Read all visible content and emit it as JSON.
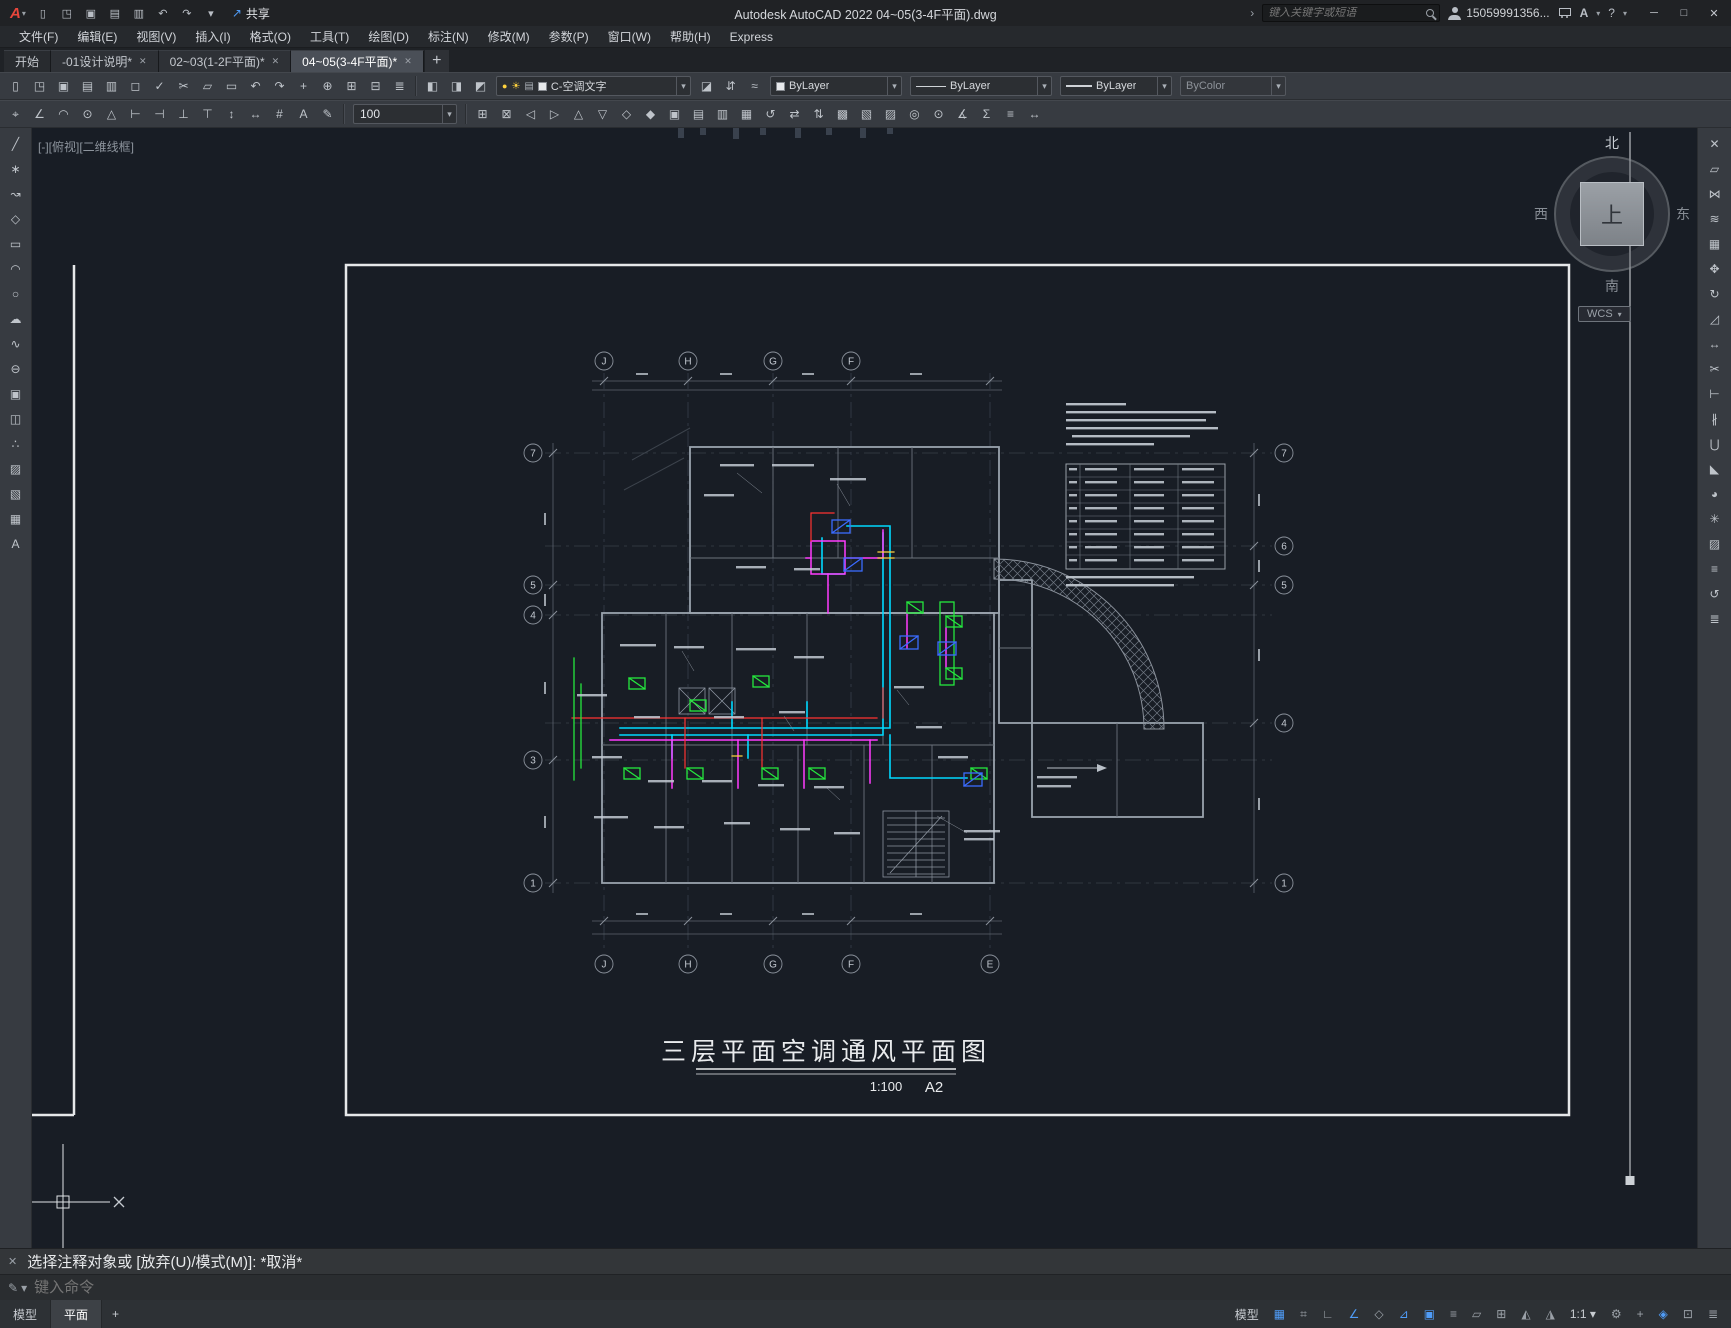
{
  "titlebar": {
    "logo": "A",
    "logo_caret": "▾",
    "qat": [
      {
        "name": "new-file-icon",
        "glyph": "▯"
      },
      {
        "name": "open-file-icon",
        "glyph": "◳"
      },
      {
        "name": "save-icon",
        "glyph": "▣"
      },
      {
        "name": "save-as-icon",
        "glyph": "▤"
      },
      {
        "name": "plot-icon",
        "glyph": "▥"
      },
      {
        "name": "undo-icon",
        "glyph": "↶"
      },
      {
        "name": "redo-icon",
        "glyph": "↷"
      },
      {
        "name": "qat-customize-icon",
        "glyph": "▾"
      }
    ],
    "share_icon": "↗",
    "share_label": "共享",
    "title": "Autodesk AutoCAD 2022   04~05(3-4F平面).dwg",
    "search_chevron": "›",
    "search_placeholder": "键入关键字或短语",
    "username": "15059991356...",
    "a_badge": "A",
    "help_badge": "?",
    "window": {
      "minimize": "─",
      "maximize": "□",
      "close": "✕"
    }
  },
  "menubar": {
    "items": [
      "文件(F)",
      "编辑(E)",
      "视图(V)",
      "插入(I)",
      "格式(O)",
      "工具(T)",
      "绘图(D)",
      "标注(N)",
      "修改(M)",
      "参数(P)",
      "窗口(W)",
      "帮助(H)",
      "Express"
    ]
  },
  "filetabs": {
    "tabs": [
      "开始",
      "-01设计说明*",
      "02~03(1-2F平面)*",
      "04~05(3-4F平面)*"
    ],
    "close_glyph": "✕",
    "new_tab": "+"
  },
  "toolbar": {
    "row1a": [
      {
        "name": "new-icon",
        "glyph": "▯"
      },
      {
        "name": "open-icon",
        "glyph": "◳"
      },
      {
        "name": "save-icon",
        "glyph": "▣"
      },
      {
        "name": "save-as-icon",
        "glyph": "▤"
      },
      {
        "name": "plot-icon",
        "glyph": "▥"
      },
      {
        "name": "plot-preview-icon",
        "glyph": "◻"
      },
      {
        "name": "spell-check-icon",
        "glyph": "✓"
      },
      {
        "name": "cut-icon",
        "glyph": "✂"
      },
      {
        "name": "copy-clip-icon",
        "glyph": "▱"
      },
      {
        "name": "paste-icon",
        "glyph": "▭"
      },
      {
        "name": "undo-icon",
        "glyph": "↶"
      },
      {
        "name": "redo-icon",
        "glyph": "↷"
      },
      {
        "name": "pan-icon",
        "glyph": "+"
      },
      {
        "name": "zoom-realtime-icon",
        "glyph": "⊕"
      },
      {
        "name": "zoom-window-icon",
        "glyph": "⊞"
      },
      {
        "name": "zoom-previous-icon",
        "glyph": "⊟"
      },
      {
        "name": "layer-properties-icon",
        "glyph": "≣"
      }
    ],
    "layer_tools": [
      {
        "name": "layer-states-icon",
        "glyph": "◧"
      },
      {
        "name": "layer-isolate-icon",
        "glyph": "◨"
      },
      {
        "name": "layer-unisolate-icon",
        "glyph": "◩"
      }
    ],
    "layer_combo": "C-空调文字",
    "row1b": [
      {
        "name": "make-current-layer-icon",
        "glyph": "◪"
      },
      {
        "name": "layer-previous-icon",
        "glyph": "⇵"
      },
      {
        "name": "match-properties-icon",
        "glyph": "≈"
      }
    ],
    "color_combo": "ByLayer",
    "linetype_combo": "ByLayer",
    "lineweight_combo": "ByLayer",
    "plotstyle_combo": "ByColor",
    "row2a": [
      {
        "name": "dim-center-mark-icon",
        "glyph": "⌖"
      },
      {
        "name": "dim-angular-icon",
        "glyph": "∠"
      },
      {
        "name": "dim-arc-length-icon",
        "glyph": "◠"
      },
      {
        "name": "dim-radius-icon",
        "glyph": "⊙"
      },
      {
        "name": "geometric-tolerance-icon",
        "glyph": "△"
      },
      {
        "name": "dim-baseline-icon",
        "glyph": "⊢"
      },
      {
        "name": "dim-continue-icon",
        "glyph": "⊣"
      },
      {
        "name": "dim-ordinate-icon",
        "glyph": "⊥"
      },
      {
        "name": "datum-icon",
        "glyph": "⊤"
      },
      {
        "name": "dim-vertical-icon",
        "glyph": "↕"
      },
      {
        "name": "dim-horizontal-icon",
        "glyph": "↔"
      },
      {
        "name": "snap-grid-icon",
        "glyph": "#"
      },
      {
        "name": "text-style-icon",
        "glyph": "A"
      },
      {
        "name": "edit-text-icon",
        "glyph": "✎"
      }
    ],
    "text_height": "100",
    "row2b": [
      {
        "name": "table-cell-icon",
        "glyph": "⊞"
      },
      {
        "name": "merge-cells-icon",
        "glyph": "⊠"
      },
      {
        "name": "align-left-icon",
        "glyph": "◁"
      },
      {
        "name": "align-right-icon",
        "glyph": "▷"
      },
      {
        "name": "align-top-icon",
        "glyph": "△"
      },
      {
        "name": "align-bottom-icon",
        "glyph": "▽"
      },
      {
        "name": "block-icon",
        "glyph": "◇"
      },
      {
        "name": "block-edit-icon",
        "glyph": "◆"
      },
      {
        "name": "attach-xref-icon",
        "glyph": "▣"
      },
      {
        "name": "image-attach-icon",
        "glyph": "▤"
      },
      {
        "name": "ole-object-icon",
        "glyph": "▥"
      },
      {
        "name": "field-icon",
        "glyph": "▦"
      },
      {
        "name": "update-icon",
        "glyph": "↺"
      },
      {
        "name": "sync-icon",
        "glyph": "⇄"
      },
      {
        "name": "draw-order-icon",
        "glyph": "⇅"
      },
      {
        "name": "region-icon",
        "glyph": "▩"
      },
      {
        "name": "boundary-icon",
        "glyph": "▧"
      },
      {
        "name": "wipeout-icon",
        "glyph": "▨"
      },
      {
        "name": "donut-icon",
        "glyph": "◎"
      },
      {
        "name": "point-style-icon",
        "glyph": "⊙"
      },
      {
        "name": "measure-icon",
        "glyph": "∡"
      },
      {
        "name": "area-icon",
        "glyph": "Σ"
      },
      {
        "name": "list-icon",
        "glyph": "≡"
      },
      {
        "name": "distance-icon",
        "glyph": "↔"
      }
    ]
  },
  "side_toolbars": {
    "left": [
      {
        "name": "line-icon",
        "glyph": "╱"
      },
      {
        "name": "construction-line-icon",
        "glyph": "∗"
      },
      {
        "name": "polyline-icon",
        "glyph": "↝"
      },
      {
        "name": "polygon-icon",
        "glyph": "◇"
      },
      {
        "name": "rectangle-icon",
        "glyph": "▭"
      },
      {
        "name": "arc-icon",
        "glyph": "◠"
      },
      {
        "name": "circle-icon",
        "glyph": "○"
      },
      {
        "name": "revision-cloud-icon",
        "glyph": "☁"
      },
      {
        "name": "spline-icon",
        "glyph": "∿"
      },
      {
        "name": "ellipse-icon",
        "glyph": "⊖"
      },
      {
        "name": "insert-block-icon",
        "glyph": "▣"
      },
      {
        "name": "create-block-icon",
        "glyph": "◫"
      },
      {
        "name": "point-icon",
        "glyph": "∴"
      },
      {
        "name": "hatch-icon",
        "glyph": "▨"
      },
      {
        "name": "gradient-icon",
        "glyph": "▧"
      },
      {
        "name": "table-icon",
        "glyph": "▦"
      },
      {
        "name": "multiline-text-icon",
        "glyph": "A"
      }
    ],
    "right": [
      {
        "name": "erase-icon",
        "glyph": "✕"
      },
      {
        "name": "copy-icon",
        "glyph": "▱"
      },
      {
        "name": "mirror-icon",
        "glyph": "⋈"
      },
      {
        "name": "offset-icon",
        "glyph": "≋"
      },
      {
        "name": "array-icon",
        "glyph": "▦"
      },
      {
        "name": "move-icon",
        "glyph": "✥"
      },
      {
        "name": "rotate-icon",
        "glyph": "↻"
      },
      {
        "name": "scale-icon",
        "glyph": "◿"
      },
      {
        "name": "stretch-icon",
        "glyph": "↔"
      },
      {
        "name": "trim-icon",
        "glyph": "✂"
      },
      {
        "name": "extend-icon",
        "glyph": "⊢"
      },
      {
        "name": "break-icon",
        "glyph": "∦"
      },
      {
        "name": "join-icon",
        "glyph": "⋃"
      },
      {
        "name": "chamfer-icon",
        "glyph": "◣"
      },
      {
        "name": "fillet-icon",
        "glyph": "◕"
      },
      {
        "name": "explode-icon",
        "glyph": "✳"
      },
      {
        "name": "hatch-edit-icon",
        "glyph": "▨"
      },
      {
        "name": "properties-icon",
        "glyph": "≡"
      },
      {
        "name": "undo-mark-icon",
        "glyph": "↺"
      },
      {
        "name": "panel-menu-icon",
        "glyph": "≣"
      }
    ]
  },
  "canvas": {
    "viewport_label": "[-][俯视][二维线框]",
    "viewcube": {
      "north": "北",
      "south": "南",
      "west": "西",
      "east": "东",
      "top": "上",
      "wcs": "WCS"
    },
    "grid": {
      "top": [
        "J",
        "H",
        "G",
        "F"
      ],
      "bottom": [
        "J",
        "H",
        "G",
        "F",
        "E"
      ],
      "left": [
        "7",
        "5",
        "4",
        "3",
        "1"
      ],
      "right": [
        "7",
        "6",
        "5",
        "4",
        "1"
      ]
    },
    "drawing": {
      "title": "三层平面空调通风平面图",
      "scale": "1:100",
      "sheet": "A2"
    }
  },
  "commandline": {
    "close_icon": "✕",
    "tool_icon": "✎",
    "tool_caret": "▾",
    "history": "选择注释对象或 [放弃(U)/模式(M)]: *取消*",
    "placeholder": "键入命令"
  },
  "statusbar": {
    "model_tab": "模型",
    "layout_tab": "平面",
    "new_layout": "+",
    "icons": [
      {
        "name": "model-space-button",
        "glyph": "模型",
        "color": "#c8ccd1"
      },
      {
        "name": "grid-display-icon",
        "glyph": "▦",
        "color": "#4f9cf7"
      },
      {
        "name": "snap-mode-icon",
        "glyph": "⌗",
        "color": "#9aa0a7"
      },
      {
        "name": "ortho-mode-icon",
        "glyph": "∟",
        "color": "#9aa0a7"
      },
      {
        "name": "polar-tracking-icon",
        "glyph": "∠",
        "color": "#4f9cf7"
      },
      {
        "name": "isodraft-icon",
        "glyph": "◇",
        "color": "#9aa0a7"
      },
      {
        "name": "object-snap-tracking-icon",
        "glyph": "⊿",
        "color": "#4f9cf7"
      },
      {
        "name": "object-snap-icon",
        "glyph": "▣",
        "color": "#4f9cf7"
      },
      {
        "name": "lineweight-display-icon",
        "glyph": "≡",
        "color": "#9aa0a7"
      },
      {
        "name": "transparency-icon",
        "glyph": "▱",
        "color": "#9aa0a7"
      },
      {
        "name": "selection-cycling-icon",
        "glyph": "⊞",
        "color": "#9aa0a7"
      },
      {
        "name": "annotation-visibility-icon",
        "glyph": "◭",
        "color": "#9aa0a7"
      },
      {
        "name": "autoscale-icon",
        "glyph": "◮",
        "color": "#9aa0a7"
      },
      {
        "name": "annotation-scale-button",
        "glyph": "1:1 ▾",
        "color": "#c8ccd1"
      },
      {
        "name": "workspace-switching-icon",
        "glyph": "⚙",
        "color": "#9aa0a7"
      },
      {
        "name": "annotation-monitor-icon",
        "glyph": "+",
        "color": "#9aa0a7"
      },
      {
        "name": "graphics-performance-icon",
        "glyph": "◈",
        "color": "#4f9cf7"
      },
      {
        "name": "clean-screen-icon",
        "glyph": "⊡",
        "color": "#9aa0a7"
      },
      {
        "name": "customization-icon",
        "glyph": "≣",
        "color": "#9aa0a7"
      }
    ]
  }
}
